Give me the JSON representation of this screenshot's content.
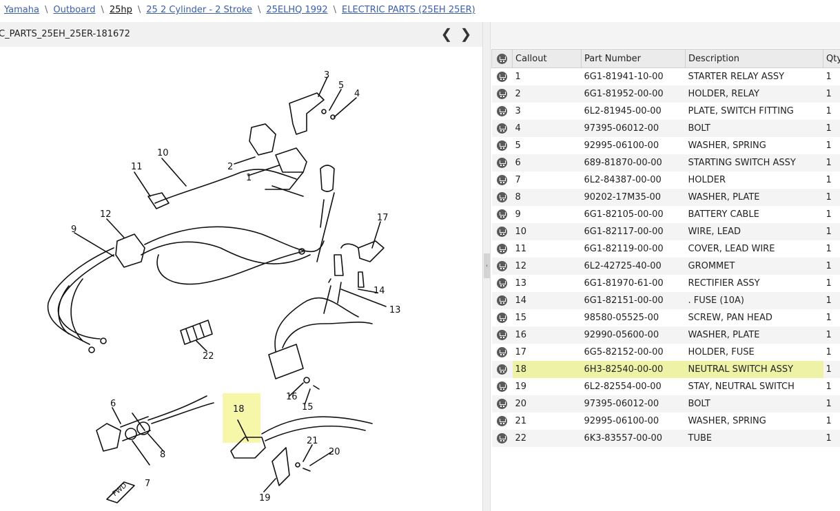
{
  "breadcrumb": [
    "Yamaha",
    "Outboard",
    "25hp",
    "25 2 Cylinder - 2 Stroke",
    "25ELHQ 1992",
    "ELECTRIC PARTS (25EH 25ER)"
  ],
  "breadcrumb_sep": "\\",
  "diagram": {
    "title": "C_PARTS_25EH_25ER-181672",
    "prev": "❮",
    "next": "❯",
    "callouts": [
      "1",
      "2",
      "3",
      "4",
      "5",
      "6",
      "7",
      "8",
      "9",
      "10",
      "11",
      "12",
      "13",
      "14",
      "15",
      "16",
      "17",
      "18",
      "19",
      "20",
      "21",
      "22"
    ],
    "fwd_label": "FWD",
    "highlight_color": "#f6f7a8"
  },
  "splitter_glyph": "‹",
  "table": {
    "headers": [
      "",
      "Callout",
      "Part Number",
      "Description",
      "Qty"
    ],
    "highlight_callout": "18",
    "rows": [
      {
        "callout": "1",
        "part": "6G1-81941-10-00",
        "desc": "STARTER RELAY ASSY",
        "qty": "1"
      },
      {
        "callout": "2",
        "part": "6G1-81952-00-00",
        "desc": "HOLDER, RELAY",
        "qty": "1"
      },
      {
        "callout": "3",
        "part": "6L2-81945-00-00",
        "desc": "PLATE, SWITCH FITTING",
        "qty": "1"
      },
      {
        "callout": "4",
        "part": "97395-06012-00",
        "desc": "BOLT",
        "qty": "1"
      },
      {
        "callout": "5",
        "part": "92995-06100-00",
        "desc": "WASHER, SPRING",
        "qty": "1"
      },
      {
        "callout": "6",
        "part": "689-81870-00-00",
        "desc": "STARTING SWITCH ASSY",
        "qty": "1"
      },
      {
        "callout": "7",
        "part": "6L2-84387-00-00",
        "desc": "HOLDER",
        "qty": "1"
      },
      {
        "callout": "8",
        "part": "90202-17M35-00",
        "desc": "WASHER, PLATE",
        "qty": "1"
      },
      {
        "callout": "9",
        "part": "6G1-82105-00-00",
        "desc": "BATTERY CABLE",
        "qty": "1"
      },
      {
        "callout": "10",
        "part": "6G1-82117-00-00",
        "desc": "WIRE, LEAD",
        "qty": "1"
      },
      {
        "callout": "11",
        "part": "6G1-82119-00-00",
        "desc": "COVER, LEAD WIRE",
        "qty": "1"
      },
      {
        "callout": "12",
        "part": "6L2-42725-40-00",
        "desc": "GROMMET",
        "qty": "1"
      },
      {
        "callout": "13",
        "part": "6G1-81970-61-00",
        "desc": "RECTIFIER ASSY",
        "qty": "1"
      },
      {
        "callout": "14",
        "part": "6G1-82151-00-00",
        "desc": ". FUSE (10A)",
        "qty": "1"
      },
      {
        "callout": "15",
        "part": "98580-05525-00",
        "desc": "SCREW, PAN HEAD",
        "qty": "1"
      },
      {
        "callout": "16",
        "part": "92990-05600-00",
        "desc": "WASHER, PLATE",
        "qty": "1"
      },
      {
        "callout": "17",
        "part": "6G5-82152-00-00",
        "desc": "HOLDER, FUSE",
        "qty": "1"
      },
      {
        "callout": "18",
        "part": "6H3-82540-00-00",
        "desc": "NEUTRAL SWITCH ASSY",
        "qty": "1"
      },
      {
        "callout": "19",
        "part": "6L2-82554-00-00",
        "desc": "STAY, NEUTRAL SWITCH",
        "qty": "1"
      },
      {
        "callout": "20",
        "part": "97395-06012-00",
        "desc": "BOLT",
        "qty": "1"
      },
      {
        "callout": "21",
        "part": "92995-06100-00",
        "desc": "WASHER, SPRING",
        "qty": "1"
      },
      {
        "callout": "22",
        "part": "6K3-83557-00-00",
        "desc": "TUBE",
        "qty": "1"
      }
    ]
  }
}
